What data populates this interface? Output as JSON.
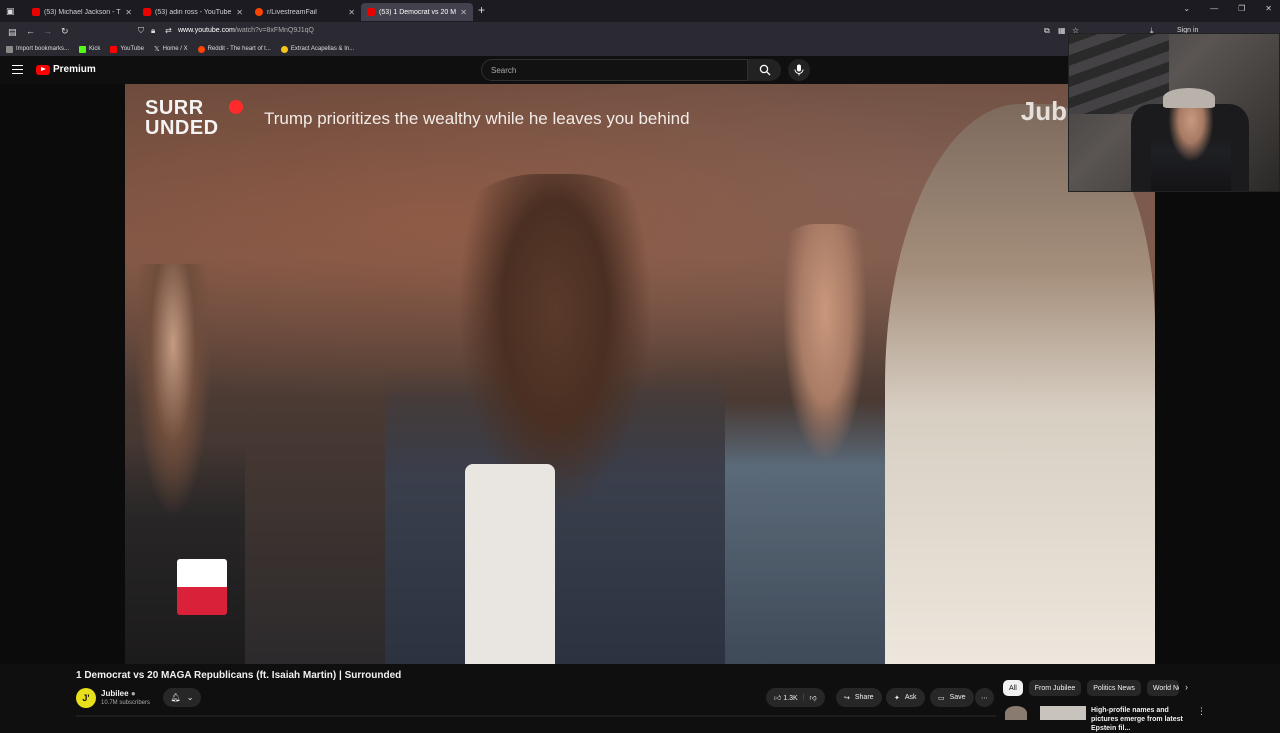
{
  "browser": {
    "tabs": [
      {
        "title": "(53) Michael Jackson - The...",
        "active": false
      },
      {
        "title": "(53) adin ross - YouTube",
        "active": false
      },
      {
        "title": "r/LivestreamFail",
        "active": false
      },
      {
        "title": "(53) 1 Democrat vs 20 MAG...",
        "active": true
      }
    ],
    "url_host": "www.youtube.com",
    "url_path": "/watch?v=8xFMnQ9J1qQ",
    "sign_in": "Sign in",
    "bookmarks": [
      {
        "label": "Import bookmarks...",
        "color": "#8a8a8a"
      },
      {
        "label": "Kick",
        "color": "#53fc18"
      },
      {
        "label": "YouTube",
        "color": "#ff0000"
      },
      {
        "label": "Home / X",
        "color": "#ffffff"
      },
      {
        "label": "Reddit - The heart of t...",
        "color": "#ff4500"
      },
      {
        "label": "Extract Acapellas & In...",
        "color": "#f5c518"
      }
    ]
  },
  "youtube": {
    "logo_label": "Premium",
    "search_placeholder": "Search",
    "video": {
      "overlay_logo_line1": "SURR",
      "overlay_logo_line2": "UNDED",
      "overlay_caption": "Trump prioritizes the wealthy while he leaves you behind",
      "overlay_brand": "Jub",
      "corner_badge": "J'"
    },
    "title": "1 Democrat vs 20 MAGA Republicans (ft. Isaiah Martin) | Surrounded",
    "channel": {
      "avatar_letter": "J'",
      "name": "Jubilee",
      "subscribers": "10.7M subscribers"
    },
    "actions": {
      "like_count": "1.3K",
      "share": "Share",
      "ask": "Ask",
      "save": "Save"
    },
    "chips": [
      "All",
      "From Jubilee",
      "Politics News",
      "World Ne"
    ],
    "recommendation": {
      "title": "High-profile names and pictures emerge from latest Epstein fil..."
    }
  }
}
